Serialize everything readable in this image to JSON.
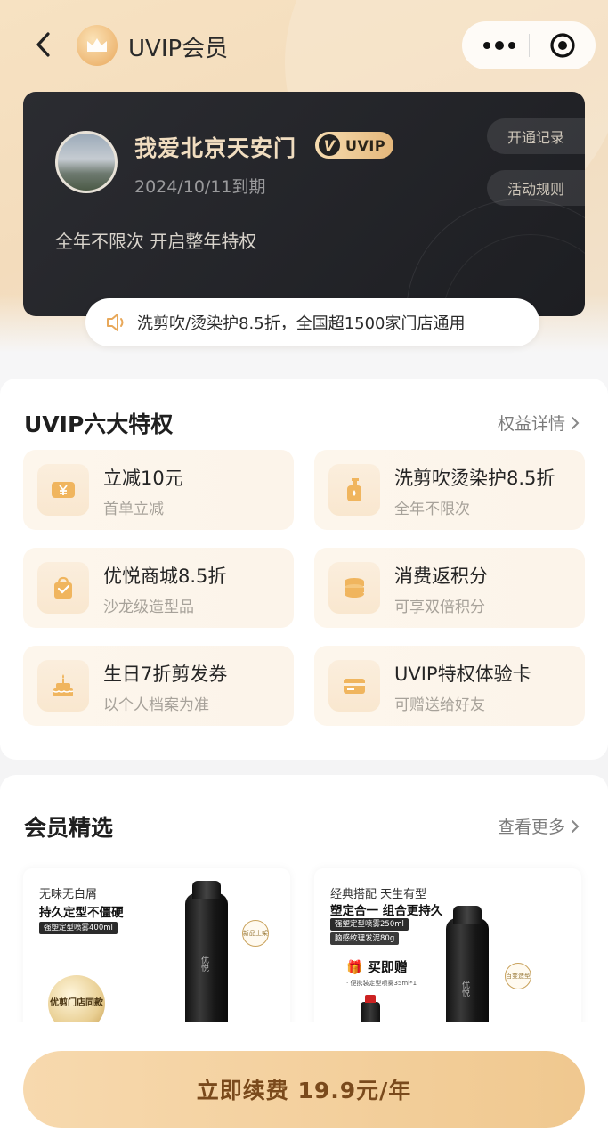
{
  "nav": {
    "title": "UVIP会员",
    "back_icon": "chevron-left-icon",
    "logo_icon": "crown-icon",
    "more_icon": "more-dots-icon",
    "close_icon": "target-icon"
  },
  "card": {
    "user_name": "我爱北京天安门",
    "badge_text": "UVIP",
    "badge_v": "V",
    "expire": "2024/10/11到期",
    "slogan": "全年不限次 开启整年特权",
    "records_label": "开通记录",
    "rules_label": "活动规则"
  },
  "notice": {
    "icon": "speaker-icon",
    "text": "洗剪吹/烫染护8.5折，全国超1500家门店通用"
  },
  "privileges": {
    "title": "UVIP六大特权",
    "more_label": "权益详情",
    "items": [
      {
        "title": "立减10元",
        "sub": "首单立减",
        "icon": "coupon-icon"
      },
      {
        "title": "洗剪吹烫染护8.5折",
        "sub": "全年不限次",
        "icon": "shampoo-bottle-icon"
      },
      {
        "title": "优悦商城8.5折",
        "sub": "沙龙级造型品",
        "icon": "shopping-bag-icon"
      },
      {
        "title": "消费返积分",
        "sub": "可享双倍积分",
        "icon": "coin-stack-icon"
      },
      {
        "title": "生日7折剪发券",
        "sub": "以个人档案为准",
        "icon": "birthday-cake-icon"
      },
      {
        "title": "UVIP特权体验卡",
        "sub": "可赠送给好友",
        "icon": "card-icon"
      }
    ]
  },
  "picks": {
    "title": "会员精选",
    "more_label": "查看更多",
    "products": [
      {
        "line1": "无味无白屑",
        "line2": "持久定型不僵硬",
        "tag": "强塑定型喷雾400ml",
        "seal": "新品上架",
        "medal": "优剪门店同款",
        "bottle_label": "优悦"
      },
      {
        "line1": "经典搭配 天生有型",
        "line2": "塑定合一 组合更持久",
        "tag1": "强塑定型喷雾250ml",
        "tag2": "脑感纹理发泥80g",
        "gift": "买即赠",
        "gift_sub": "· 便携装定型喷雾35ml*1",
        "seal": "百变造型",
        "bottle_label": "优悦"
      }
    ]
  },
  "cta": {
    "label": "立即续费 19.9元/年"
  },
  "colors": {
    "hero_bg": "#f5dfbf",
    "card_bg": "#222327",
    "accent_gold": "#e8b878",
    "cta_text": "#7a4a1c"
  }
}
